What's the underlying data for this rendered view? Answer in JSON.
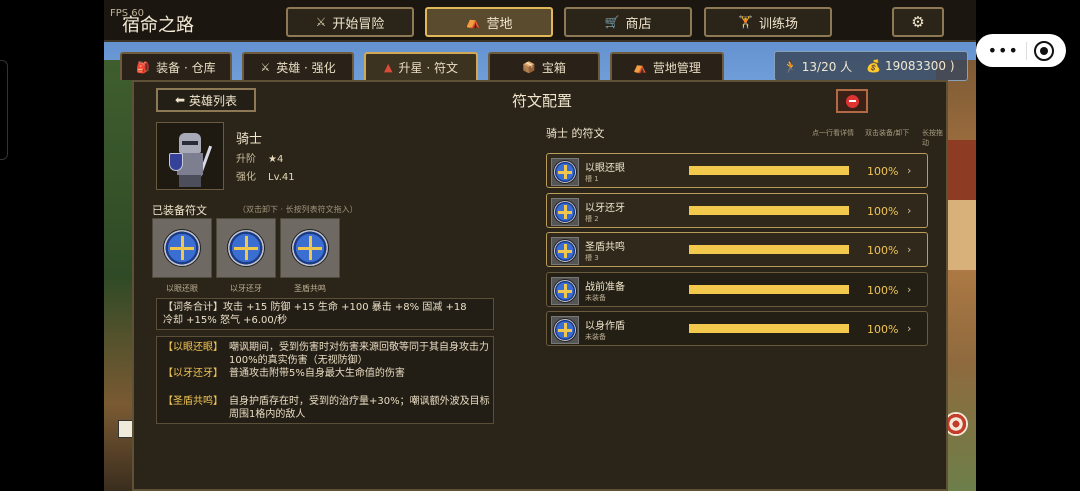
{
  "fps": "FPS 60",
  "game_title": "宿命之路",
  "nav": [
    {
      "label": "开始冒险",
      "icon": "⚔"
    },
    {
      "label": "营地",
      "icon": "⛺"
    },
    {
      "label": "商店",
      "icon": "🛒"
    },
    {
      "label": "训练场",
      "icon": "🏋"
    }
  ],
  "settings_icon": "⚙",
  "tabs": [
    {
      "label": "装备 · 仓库",
      "icon": "🎒"
    },
    {
      "label": "英雄 · 强化",
      "icon": "⚔"
    },
    {
      "label": "升星 · 符文",
      "icon": "▲"
    },
    {
      "label": "宝箱",
      "icon": "📦"
    },
    {
      "label": "营地管理",
      "icon": "⛺"
    }
  ],
  "resources": {
    "population": "13/20 人",
    "population_icon": "🏃",
    "gold": "19083300 )",
    "gold_icon": "💰"
  },
  "panel": {
    "back_label": "英雄列表",
    "back_icon": "⬅",
    "title": "符文配置"
  },
  "hero": {
    "name": "骑士",
    "rank_label": "升阶",
    "rank_value": "★4",
    "enhance_label": "强化",
    "enhance_value": "Lv.41"
  },
  "equipped": {
    "title": "已装备符文",
    "hint": "（双击卸下 · 长按列表符文拖入）",
    "slots": [
      "以眼还眼",
      "以牙还牙",
      "圣盾共鸣"
    ]
  },
  "summary": {
    "line1": "【词条合计】攻击 +15    防御 +15    生命 +100    暴击 +8%    固减 +18",
    "line2": "冷却 +15%    怒气 +6.00/秒"
  },
  "descriptions": [
    {
      "name": "【以眼还眼】",
      "text": "嘲讽期间，受到伤害时对伤害来源回敬等同于其自身攻击力100%的真实伤害（无视防御）"
    },
    {
      "name": "【以牙还牙】",
      "text": "普通攻击附带5%自身最大生命值的伤害"
    },
    {
      "name": "【圣盾共鸣】",
      "text": "自身护盾存在时，受到的治疗量+30%；嘲讽额外波及目标周围1格内的敌人"
    }
  ],
  "rune_list": {
    "title": "骑士 的符文",
    "hints": [
      "点一行看详情",
      "双击装备/卸下",
      "长按拖动"
    ],
    "rows": [
      {
        "name": "以眼还眼",
        "sub": "槽 1",
        "pct": "100%",
        "fill": 1.0
      },
      {
        "name": "以牙还牙",
        "sub": "槽 2",
        "pct": "100%",
        "fill": 1.0
      },
      {
        "name": "圣盾共鸣",
        "sub": "槽 3",
        "pct": "100%",
        "fill": 1.0
      },
      {
        "name": "战前准备",
        "sub": "未装备",
        "pct": "100%",
        "fill": 1.0
      },
      {
        "name": "以身作盾",
        "sub": "未装备",
        "pct": "100%",
        "fill": 1.0
      }
    ],
    "chevron": "›"
  },
  "capsule": {
    "more": "•••"
  }
}
